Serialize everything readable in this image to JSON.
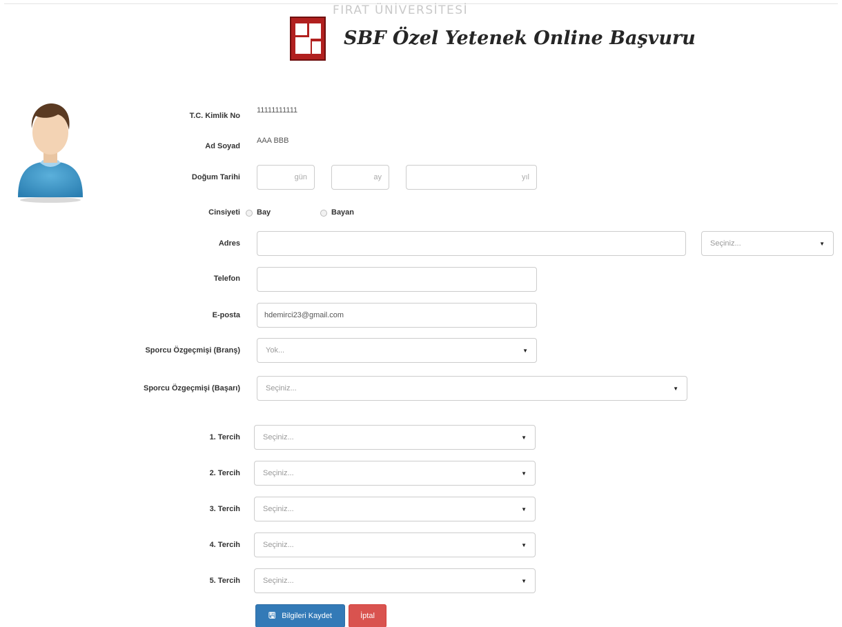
{
  "header": {
    "university": "FIRAT ÜNİVERSİTESİ",
    "title": "SBF Özel Yetenek Online Başvuru"
  },
  "form": {
    "tc": {
      "label": "T.C. Kimlik No",
      "value": "11111111111"
    },
    "name": {
      "label": "Ad Soyad",
      "value": "AAA BBB"
    },
    "birth": {
      "label": "Doğum Tarihi",
      "day_placeholder": "gün",
      "month_placeholder": "ay",
      "year_placeholder": "yıl"
    },
    "gender": {
      "label": "Cinsiyeti",
      "option_male": "Bay",
      "option_female": "Bayan"
    },
    "address": {
      "label": "Adres",
      "value": "",
      "city_select": "Seçiniz..."
    },
    "phone": {
      "label": "Telefon",
      "value": ""
    },
    "email": {
      "label": "E-posta",
      "value": "hdemirci23@gmail.com"
    },
    "branch": {
      "label": "Sporcu Özgeçmişi (Branş)",
      "value": "Yok..."
    },
    "success": {
      "label": "Sporcu Özgeçmişi (Başarı)",
      "value": "Seçiniz..."
    },
    "preferences": [
      {
        "label": "1. Tercih",
        "value": "Seçiniz..."
      },
      {
        "label": "2. Tercih",
        "value": "Seçiniz..."
      },
      {
        "label": "3. Tercih",
        "value": "Seçiniz..."
      },
      {
        "label": "4. Tercih",
        "value": "Seçiniz..."
      },
      {
        "label": "5. Tercih",
        "value": "Seçiniz..."
      }
    ]
  },
  "buttons": {
    "save": "Bilgileri Kaydet",
    "cancel": "İptal"
  },
  "colors": {
    "primary": "#337ab7",
    "danger": "#d9534f",
    "logo": "#b1201f"
  },
  "icons": {
    "save": "floppy-disk-icon",
    "logo": "university-logo",
    "avatar": "user-avatar"
  }
}
